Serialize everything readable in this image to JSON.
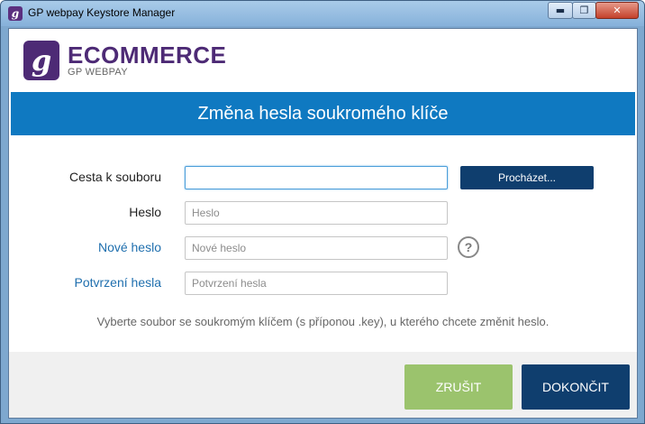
{
  "window": {
    "title": "GP webpay Keystore Manager",
    "controls": {
      "minimize": "▬",
      "maximize": "❐",
      "close": "✕"
    }
  },
  "brand": {
    "logo_icon": "gp-webpay-logo-icon",
    "name": "ECOMMERCE",
    "subtitle": "GP WEBPAY"
  },
  "banner": {
    "title": "Změna hesla soukromého klíče"
  },
  "form": {
    "file_path": {
      "label": "Cesta k souboru",
      "value": "",
      "placeholder": ""
    },
    "browse_button": "Procházet...",
    "password": {
      "label": "Heslo",
      "value": "",
      "placeholder": "Heslo"
    },
    "new_password": {
      "label": "Nové heslo",
      "value": "",
      "placeholder": "Nové heslo"
    },
    "confirm_password": {
      "label": "Potvrzení hesla",
      "value": "",
      "placeholder": "Potvrzení hesla"
    },
    "help_icon": "?",
    "hint": "Vyberte soubor se soukromým klíčem (s příponou .key), u kterého chcete změnit heslo."
  },
  "footer": {
    "cancel_button": "ZRUŠIT",
    "finish_button": "DOKONČIT"
  },
  "colors": {
    "brand_purple": "#4d2a75",
    "banner_blue": "#0f79c1",
    "primary_button": "#0f3e6e",
    "cancel_button": "#9bc36d",
    "accent_label": "#1f6fae"
  }
}
